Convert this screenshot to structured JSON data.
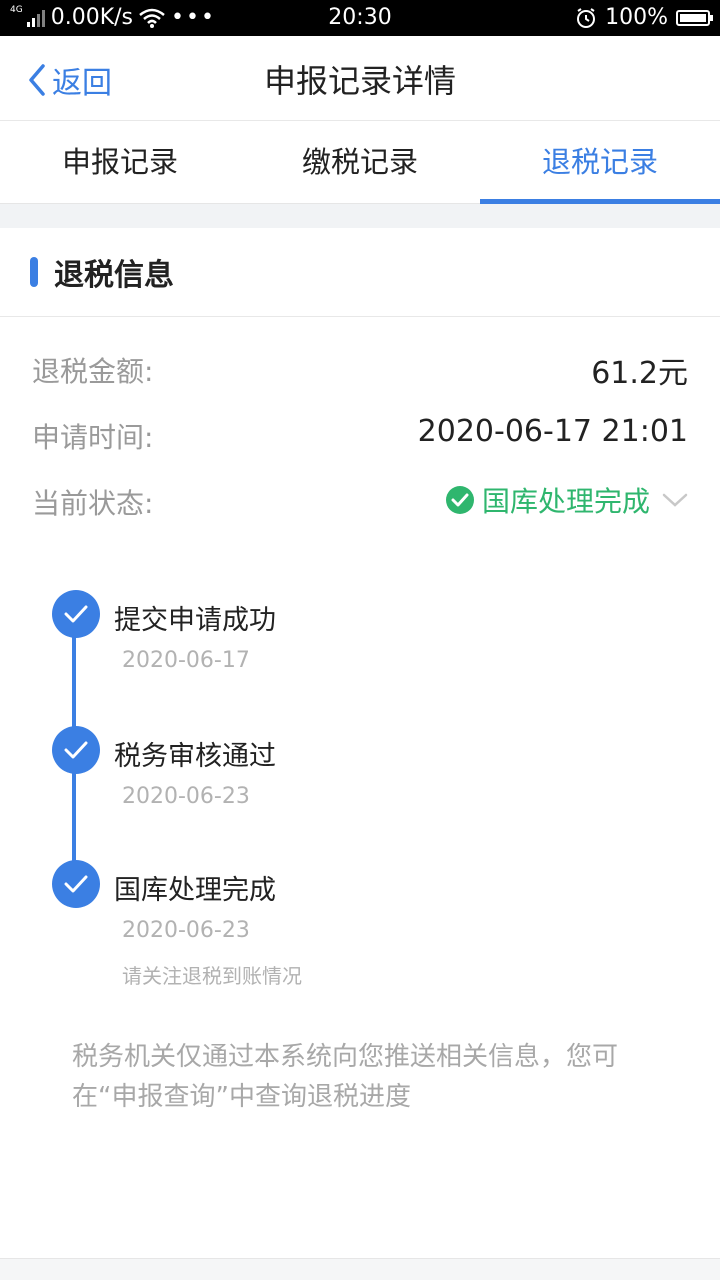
{
  "status_bar": {
    "network_type": "4G",
    "speed": "0.00K/s",
    "time": "20:30",
    "battery": "100%"
  },
  "nav": {
    "back_label": "返回",
    "title": "申报记录详情"
  },
  "tabs": [
    {
      "label": "申报记录",
      "active": false
    },
    {
      "label": "缴税记录",
      "active": false
    },
    {
      "label": "退税记录",
      "active": true
    }
  ],
  "section": {
    "title": "退税信息"
  },
  "info": {
    "amount_label": "退税金额:",
    "amount_value": "61.2元",
    "time_label": "申请时间:",
    "time_value": "2020-06-17 21:01",
    "status_label": "当前状态:",
    "status_value": "国库处理完成"
  },
  "timeline": [
    {
      "title": "提交申请成功",
      "date": "2020-06-17"
    },
    {
      "title": "税务审核通过",
      "date": "2020-06-23"
    },
    {
      "title": "国库处理完成",
      "date": "2020-06-23",
      "note": "请关注退税到账情况"
    }
  ],
  "footer": {
    "text": "税务机关仅通过本系统向您推送相关信息，您可在“申报查询”中查询退税进度"
  },
  "colors": {
    "accent": "#3b7fe3",
    "success": "#2fb66e"
  }
}
